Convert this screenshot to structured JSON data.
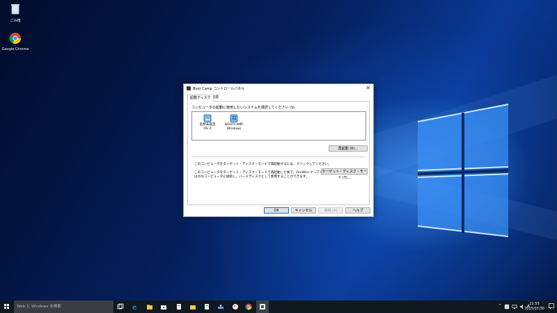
{
  "desktop": {
    "icons": [
      {
        "label": "ごみ箱",
        "icon": "recycle-bin-icon"
      },
      {
        "label": "Google Chrome",
        "icon": "chrome-icon"
      }
    ]
  },
  "dialog": {
    "title": "Boot Camp コントロールパネル",
    "tabs": [
      "起動ディスク",
      "電源"
    ],
    "prompt": "コンピュータの起動に使用したいシステムを選択してください (S)",
    "os_items": [
      {
        "line1": "名称未設定",
        "line2": "OS X",
        "icon": "mac-drive-icon"
      },
      {
        "line1": "BOOTCAMP",
        "line2": "Windows",
        "icon": "windows-drive-icon"
      }
    ],
    "restart_button": "再起動 (R)...",
    "target_mode_text1": "このコンピュータをターゲット・ディスク・モードで再起動するには、クリックしてください。",
    "target_mode_text2_line1": "このコンピュータをターゲット・ディスク・モードで再起動した後で、FireWire ケーブルを使って",
    "target_mode_text2_line2": "ほかのコンピュータに接続し、ハードディスクとして使用することができます。",
    "target_mode_button": "ターゲット・ディスク・モード (T)...",
    "footer_buttons": {
      "ok": "OK",
      "cancel": "キャンセル",
      "apply": "適用 (A)",
      "help": "ヘルプ"
    }
  },
  "taskbar": {
    "search_placeholder": "Web と Windows を検索",
    "ime": "A",
    "time": "21:55",
    "date": "2015/07/30"
  },
  "colors": {
    "accent": "#0078d7",
    "taskbar": "#101820",
    "wallpaper_glow": "#4aa8ff"
  }
}
